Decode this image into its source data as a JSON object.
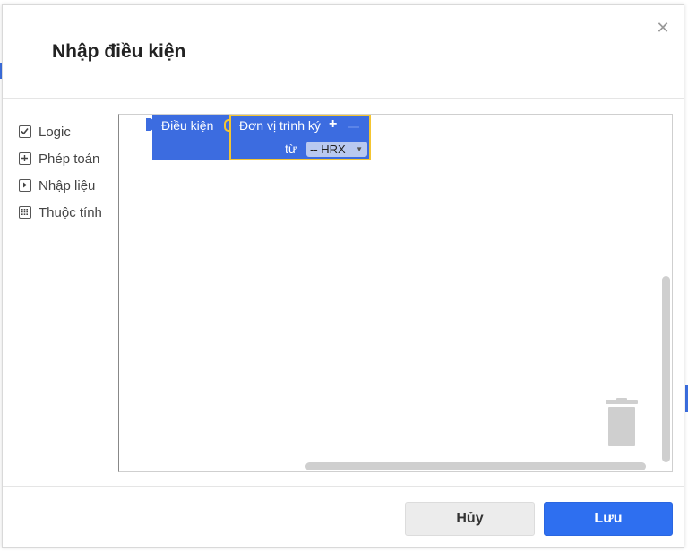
{
  "dialog": {
    "title": "Nhập điều kiện",
    "close_icon": "close-icon"
  },
  "toolbox": {
    "items": [
      {
        "label": "Logic",
        "icon": "checkbox-icon"
      },
      {
        "label": "Phép toán",
        "icon": "plus-box-icon"
      },
      {
        "label": "Nhập liệu",
        "icon": "play-box-icon"
      },
      {
        "label": "Thuộc tính",
        "icon": "grid-box-icon"
      }
    ]
  },
  "workspace": {
    "main_block": {
      "label": "Điều kiện"
    },
    "inner_block": {
      "label": "Đơn vị trình ký",
      "plus": "+",
      "from_label": "từ",
      "dropdown_value": "-- HRX"
    },
    "trash_icon": "trash-icon"
  },
  "footer": {
    "cancel_label": "Hủy",
    "save_label": "Lưu"
  },
  "colors": {
    "block_blue": "#3c6ce0",
    "block_highlight": "#f4c531",
    "primary_button": "#2e6ff0"
  }
}
